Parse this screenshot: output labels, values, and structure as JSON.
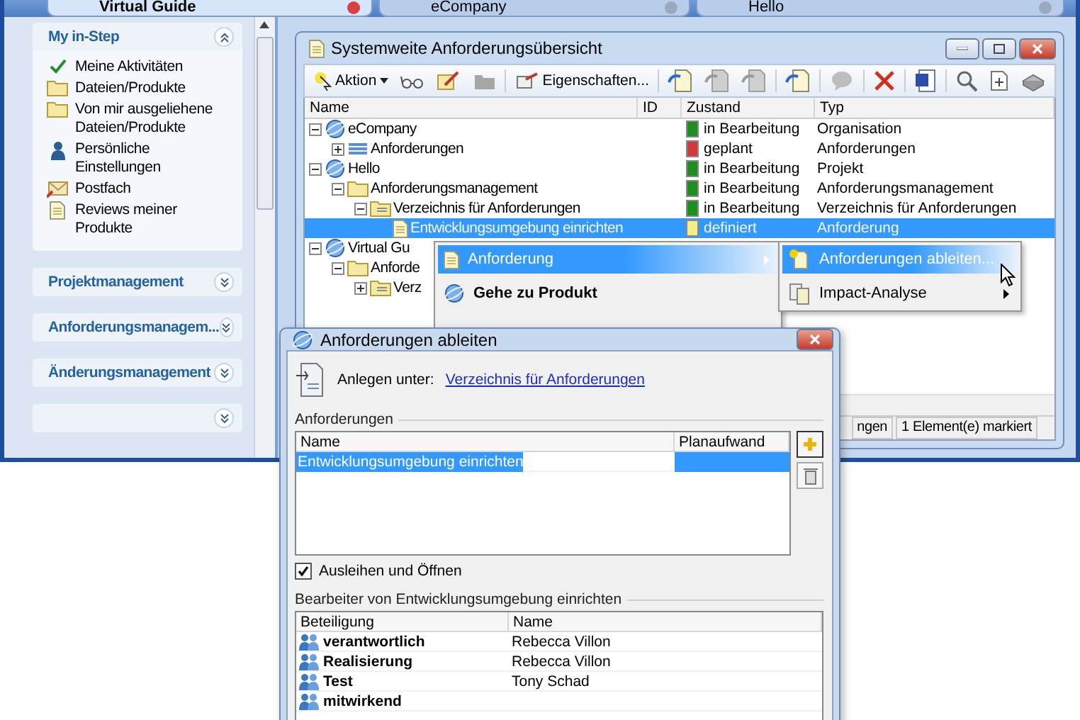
{
  "app_tabs": [
    {
      "label": "Virtual Guide",
      "selected": true
    },
    {
      "label": "eCompany",
      "selected": false
    },
    {
      "label": "Hello",
      "selected": false
    }
  ],
  "sidebar": {
    "sections": [
      {
        "title": "My in-Step",
        "expanded": true,
        "items": [
          {
            "label": "Meine Aktivitäten",
            "kind": "check"
          },
          {
            "label": "Dateien/Produkte",
            "kind": "folder"
          },
          {
            "label": "Von mir ausgeliehene Dateien/Produkte",
            "kind": "folder"
          },
          {
            "label": "Persönliche Einstellungen",
            "kind": "person"
          },
          {
            "label": "Postfach",
            "kind": "mail"
          },
          {
            "label": "Reviews meiner Produkte",
            "kind": "document"
          }
        ]
      },
      {
        "title": "Projektmanagement",
        "expanded": false
      },
      {
        "title": "Anforderungsmanagem...",
        "expanded": false
      },
      {
        "title": "Änderungsmanagement",
        "expanded": false
      },
      {
        "expanded": false
      }
    ]
  },
  "window": {
    "title": "Systemweite Anforderungsübersicht",
    "toolbar": {
      "action": "Aktion",
      "properties": "Eigenschaften..."
    },
    "columns": [
      "Name",
      "ID",
      "Zustand",
      "Typ"
    ],
    "tree": [
      {
        "name": "eCompany",
        "kind": "globe",
        "expanded": true,
        "status": "in Bearbeitung",
        "color": "#1e8c1e",
        "typ": "Organisation",
        "selected": false,
        "children": [
          {
            "name": "Anforderungen",
            "kind": "stack",
            "expanded": false,
            "status": "geplant",
            "color": "#d03a3a",
            "typ": "Anforderungen",
            "selected": false
          }
        ]
      },
      {
        "name": "Hello",
        "kind": "globe",
        "expanded": true,
        "status": "in Bearbeitung",
        "color": "#1e8c1e",
        "typ": "Projekt",
        "selected": false,
        "children": [
          {
            "name": "Anforderungsmanagement",
            "kind": "folder",
            "expanded": true,
            "status": "in Bearbeitung",
            "color": "#1e8c1e",
            "typ": "Anforderungsmanagement",
            "selected": false,
            "children": [
              {
                "name": "Verzeichnis für Anforderungen",
                "kind": "list-folder",
                "expanded": true,
                "status": "in Bearbeitung",
                "color": "#1e8c1e",
                "typ": "Verzeichnis für Anforderungen",
                "selected": false,
                "children": [
                  {
                    "name": "Entwicklungsumgebung einrichten",
                    "kind": "document",
                    "status": "definiert",
                    "color": "#f2ee8a",
                    "typ": "Anforderung",
                    "selected": true
                  }
                ]
              }
            ]
          }
        ]
      },
      {
        "name": "Virtual Gu",
        "kind": "globe",
        "expanded": true,
        "selected": false,
        "children": [
          {
            "name": "Anforde",
            "kind": "folder",
            "expanded": true,
            "selected": false,
            "children": [
              {
                "name": "Verz",
                "kind": "list-folder",
                "expanded": false,
                "selected": false
              }
            ]
          }
        ]
      }
    ],
    "status_bar": [
      "ngen",
      "1 Element(e) markiert"
    ]
  },
  "context_menu": [
    {
      "label": "Anforderung",
      "kind": "document",
      "selected": true,
      "submenu": true,
      "default": false
    },
    {
      "label": "Gehe zu Produkt",
      "kind": "globe",
      "selected": false,
      "submenu": false,
      "default": true
    }
  ],
  "submenu": [
    {
      "label": "Anforderungen ableiten...",
      "kind": "new",
      "selected": true,
      "submenu": false
    },
    {
      "label": "Impact-Analyse",
      "kind": "analysis",
      "selected": false,
      "submenu": true
    }
  ],
  "dialog": {
    "title": "Anforderungen ableiten",
    "create_under": {
      "label": "Anlegen unter:",
      "link": "Verzeichnis für Anforderungen"
    },
    "requirements": {
      "title": "Anforderungen",
      "columns": [
        "Name",
        "Planaufwand"
      ],
      "rows": [
        {
          "name": "Entwicklungsumgebung einrichten",
          "selected": true
        }
      ]
    },
    "checkout": {
      "label": "Ausleihen und Öffnen",
      "checked": true
    },
    "participants": {
      "title": "Bearbeiter von Entwicklungsumgebung einrichten",
      "columns": [
        "Beteiligung",
        "Name"
      ],
      "rows": [
        {
          "role": "verantwortlich",
          "name": "Rebecca Villon"
        },
        {
          "role": "Realisierung",
          "name": "Rebecca Villon"
        },
        {
          "role": "Test",
          "name": "Tony Schad"
        },
        {
          "role": "mitwirkend"
        }
      ]
    }
  }
}
